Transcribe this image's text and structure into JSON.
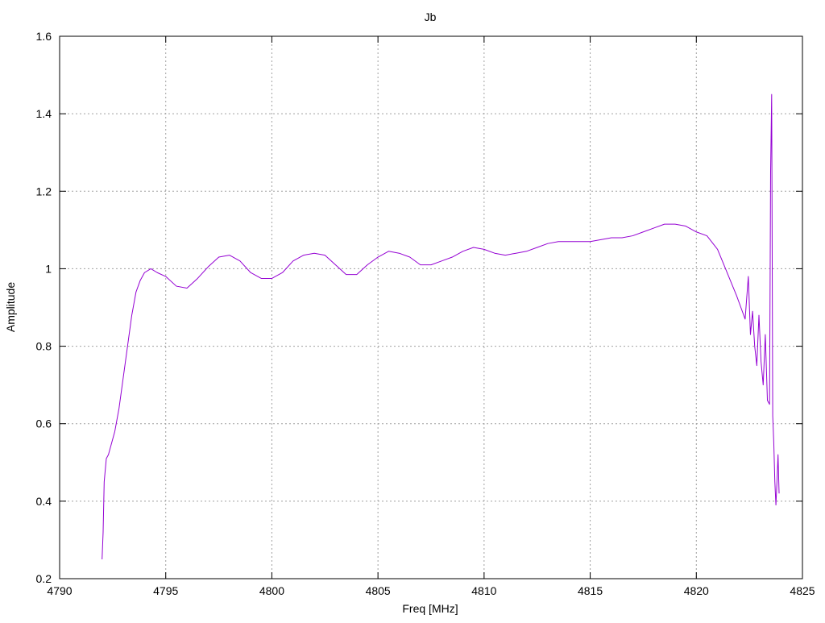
{
  "chart_data": {
    "type": "line",
    "title": "Jb",
    "xlabel": "Freq [MHz]",
    "ylabel": "Amplitude",
    "xlim": [
      4790,
      4825
    ],
    "ylim": [
      0.2,
      1.6
    ],
    "xticks": [
      4790,
      4795,
      4800,
      4805,
      4810,
      4815,
      4820,
      4825
    ],
    "yticks": [
      0.2,
      0.4,
      0.6,
      0.8,
      1.0,
      1.2,
      1.4,
      1.6
    ],
    "xtick_labels": [
      "4790",
      "4795",
      "4800",
      "4805",
      "4810",
      "4815",
      "4820",
      "4825"
    ],
    "ytick_labels": [
      "0.2",
      "0.4",
      "0.6",
      "0.8",
      "1",
      "1.2",
      "1.4",
      "1.6"
    ],
    "grid": true,
    "legend": "none",
    "series": [
      {
        "color": "#9400d3",
        "x": [
          4792.0,
          4792.05,
          4792.1,
          4792.2,
          4792.3,
          4792.45,
          4792.6,
          4792.8,
          4793.0,
          4793.2,
          4793.4,
          4793.6,
          4793.8,
          4794.0,
          4794.3,
          4794.6,
          4795.0,
          4795.5,
          4796.0,
          4796.5,
          4797.0,
          4797.5,
          4798.0,
          4798.5,
          4799.0,
          4799.5,
          4800.0,
          4800.5,
          4801.0,
          4801.5,
          4802.0,
          4802.5,
          4803.0,
          4803.5,
          4804.0,
          4804.5,
          4805.0,
          4805.5,
          4806.0,
          4806.5,
          4807.0,
          4807.5,
          4808.0,
          4808.5,
          4809.0,
          4809.5,
          4810.0,
          4810.5,
          4811.0,
          4811.5,
          4812.0,
          4812.5,
          4813.0,
          4813.5,
          4814.0,
          4814.5,
          4815.0,
          4815.5,
          4816.0,
          4816.5,
          4817.0,
          4817.5,
          4818.0,
          4818.5,
          4819.0,
          4819.5,
          4820.0,
          4820.5,
          4821.0,
          4821.3,
          4821.6,
          4821.9,
          4822.1,
          4822.3,
          4822.45,
          4822.55,
          4822.65,
          4822.75,
          4822.85,
          4822.95,
          4823.05,
          4823.15,
          4823.25,
          4823.35,
          4823.45,
          4823.5,
          4823.55,
          4823.6,
          4823.65,
          4823.7,
          4823.75,
          4823.8,
          4823.85,
          4823.9
        ],
        "y": [
          0.25,
          0.32,
          0.45,
          0.51,
          0.52,
          0.55,
          0.58,
          0.64,
          0.72,
          0.8,
          0.88,
          0.94,
          0.97,
          0.99,
          1.0,
          0.99,
          0.98,
          0.955,
          0.95,
          0.975,
          1.005,
          1.03,
          1.035,
          1.02,
          0.99,
          0.975,
          0.975,
          0.99,
          1.02,
          1.035,
          1.04,
          1.035,
          1.01,
          0.985,
          0.985,
          1.01,
          1.03,
          1.045,
          1.04,
          1.03,
          1.01,
          1.01,
          1.02,
          1.03,
          1.045,
          1.055,
          1.05,
          1.04,
          1.035,
          1.04,
          1.045,
          1.055,
          1.065,
          1.07,
          1.07,
          1.07,
          1.07,
          1.075,
          1.08,
          1.08,
          1.085,
          1.095,
          1.105,
          1.115,
          1.115,
          1.11,
          1.095,
          1.085,
          1.05,
          1.01,
          0.97,
          0.93,
          0.9,
          0.87,
          0.98,
          0.83,
          0.89,
          0.8,
          0.75,
          0.88,
          0.76,
          0.7,
          0.83,
          0.66,
          0.65,
          1.25,
          1.45,
          0.62,
          0.55,
          0.45,
          0.39,
          0.45,
          0.52,
          0.42
        ]
      }
    ]
  }
}
